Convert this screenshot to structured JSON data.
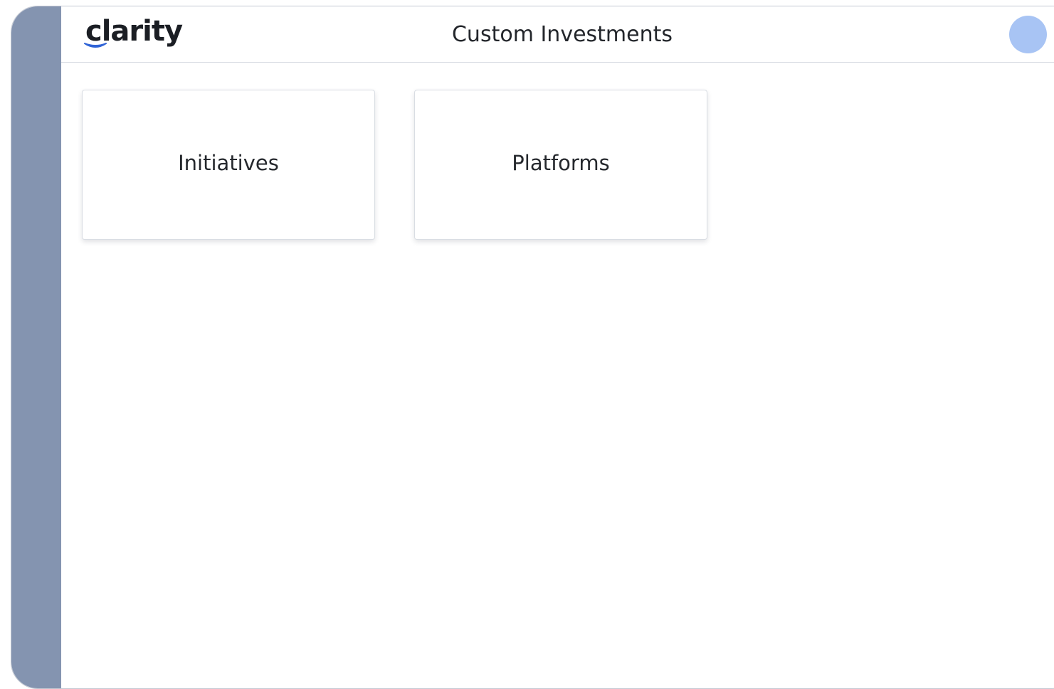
{
  "header": {
    "logo_text": "clarity",
    "title": "Custom Investments"
  },
  "cards": [
    {
      "label": "Initiatives"
    },
    {
      "label": "Platforms"
    }
  ],
  "colors": {
    "rail": "#8494b0",
    "avatar": "#a8c4f4",
    "logo_swoosh": "#2f63d6",
    "text": "#23262b"
  },
  "icons": {
    "avatar": "user-avatar-icon",
    "logo_mark": "swoosh-icon"
  }
}
